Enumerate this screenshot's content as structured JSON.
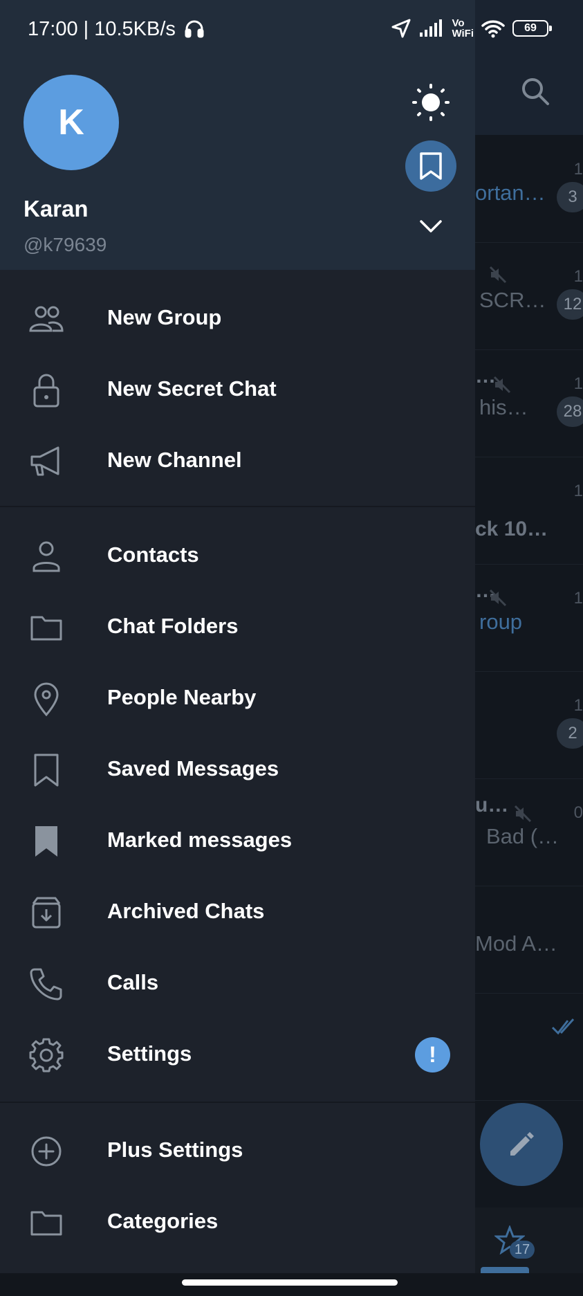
{
  "status_bar": {
    "text": "17:00 | 10.5KB/s",
    "battery": "69",
    "vowifi_top": "Vo",
    "vowifi_bottom": "WiFi"
  },
  "profile": {
    "avatar_letter": "K",
    "name": "Karan",
    "handle": "@k79639"
  },
  "menu": {
    "group1": [
      {
        "label": "New Group",
        "icon": "people-icon"
      },
      {
        "label": "New Secret Chat",
        "icon": "lock-icon"
      },
      {
        "label": "New Channel",
        "icon": "megaphone-icon"
      }
    ],
    "group2": [
      {
        "label": "Contacts",
        "icon": "person-icon"
      },
      {
        "label": "Chat Folders",
        "icon": "folder-icon"
      },
      {
        "label": "People Nearby",
        "icon": "location-pin-icon"
      },
      {
        "label": "Saved Messages",
        "icon": "bookmark-icon"
      },
      {
        "label": "Marked messages",
        "icon": "bookmark-filled-icon"
      },
      {
        "label": "Archived Chats",
        "icon": "archive-icon"
      },
      {
        "label": "Calls",
        "icon": "phone-icon"
      },
      {
        "label": "Settings",
        "icon": "gear-icon",
        "badge": "!"
      }
    ],
    "group3": [
      {
        "label": "Plus Settings",
        "icon": "plus-circle-icon"
      },
      {
        "label": "Categories",
        "icon": "folder-icon"
      }
    ]
  },
  "background_chats": [
    {
      "title": "",
      "subtitle": "ortan…",
      "time": "1",
      "badge": "3",
      "link": true
    },
    {
      "title": "",
      "subtitle": "SCR…",
      "time": "1",
      "badge": "12"
    },
    {
      "title": "…",
      "subtitle": "his…",
      "time": "1",
      "badge": "28"
    },
    {
      "title": "ck  10…",
      "subtitle": "",
      "time": "1",
      "badge": ""
    },
    {
      "title": "…",
      "subtitle": "roup",
      "time": "1",
      "badge": "",
      "link": true
    },
    {
      "title": "",
      "subtitle": "",
      "time": "1",
      "badge": "2"
    },
    {
      "title": "u…",
      "subtitle": "Bad (…",
      "time": "0",
      "badge": ""
    },
    {
      "title": "",
      "subtitle": "Mod A…",
      "time": "",
      "badge": ""
    }
  ],
  "bottom_tab_badge": "17",
  "colors": {
    "accent": "#5c9de0",
    "drawer_bg": "#1d222b",
    "header_bg": "#222d3b"
  }
}
